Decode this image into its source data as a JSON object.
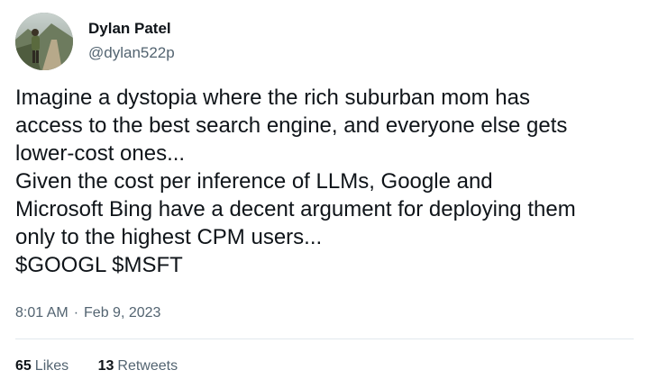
{
  "author": {
    "display_name": "Dylan Patel",
    "handle": "@dylan522p",
    "avatar_icon": "person-photo-avatar"
  },
  "tweet": {
    "lines": [
      "Imagine a dystopia where the rich suburban mom has",
      "access to the best search engine, and everyone else gets",
      "lower-cost ones...",
      "Given the cost per inference of LLMs, Google and",
      "Microsoft Bing have a decent argument for deploying them",
      "only to the highest CPM users...",
      "$GOOGL $MSFT"
    ],
    "time": "8:01 AM",
    "separator": "·",
    "date": "Feb 9, 2023"
  },
  "stats": {
    "likes_count": "65",
    "likes_label": "Likes",
    "retweets_count": "13",
    "retweets_label": "Retweets"
  },
  "colors": {
    "text": "#0f1419",
    "secondary": "#536471",
    "divider": "#e1e8ed"
  }
}
